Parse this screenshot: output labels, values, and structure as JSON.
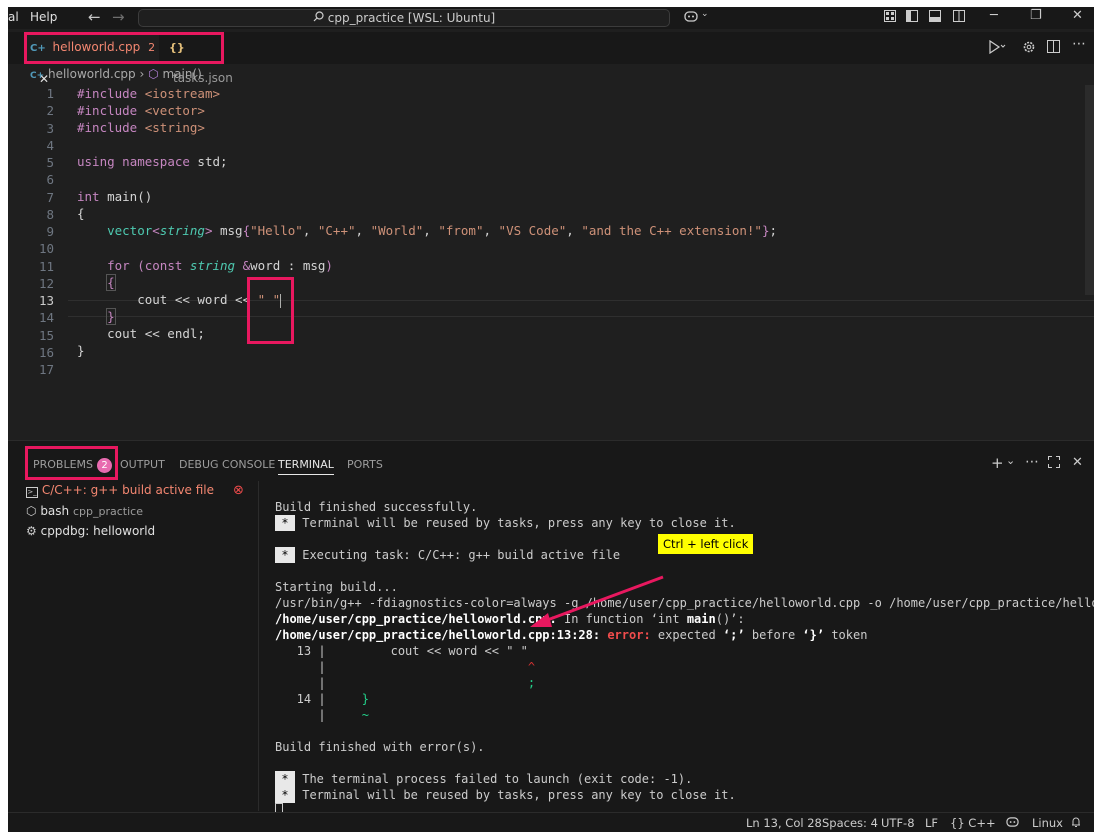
{
  "titlebar": {
    "menu_partial": "al",
    "menu_help": "Help",
    "back_glyph": "←",
    "forward_glyph": "→",
    "search_text": "cpp_practice [WSL: Ubuntu]",
    "minimize": "─",
    "maximize": "❐",
    "close": "✕"
  },
  "tabs": [
    {
      "icon": "C+",
      "label": "helloworld.cpp",
      "badge": "2",
      "close": "✕",
      "color": "#f48771"
    },
    {
      "icon": "{}",
      "label": "tasks.json",
      "color": "#999999"
    }
  ],
  "breadcrumb": {
    "file": "helloworld.cpp",
    "sep": "›",
    "symbol": "main()"
  },
  "editor": {
    "line_numbers": [
      "1",
      "2",
      "3",
      "4",
      "5",
      "6",
      "7",
      "8",
      "9",
      "10",
      "11",
      "12",
      "13",
      "14",
      "15",
      "16",
      "17"
    ],
    "current_line": "13",
    "code": [
      "#include <iostream>",
      "#include <vector>",
      "#include <string>",
      "",
      "using namespace std;",
      "",
      "int main()",
      "{",
      "    vector<string> msg{\"Hello\", \"C++\", \"World\", \"from\", \"VS Code\", \"and the C++ extension!\"};",
      "",
      "    for (const string &word : msg)",
      "    {",
      "        cout << word << \" \"",
      "    }",
      "    cout << endl;",
      "}",
      ""
    ]
  },
  "panel": {
    "tabs": [
      "PROBLEMS",
      "OUTPUT",
      "DEBUG CONSOLE",
      "TERMINAL",
      "PORTS"
    ],
    "problems_badge": "2",
    "active_tab": "TERMINAL",
    "terminals": [
      {
        "label": "C/C++: g++ build active file",
        "status": "error"
      },
      {
        "label": "bash",
        "sub": "cpp_practice"
      },
      {
        "label": "cppdbg: helloworld"
      }
    ],
    "terminal_lines": {
      "l1": "Build finished successfully.",
      "l2": " Terminal will be reused by tasks, press any key to close it.",
      "l3": " Executing task: C/C++: g++ build active file",
      "l4": "Starting build...",
      "l5": "/usr/bin/g++ -fdiagnostics-color=always -g /home/user/cpp_practice/helloworld.cpp -o /home/user/cpp_practice/helloworld",
      "l6a": "/home/user/cpp_practice/helloworld.cpp:",
      "l6b": " In function ",
      "l6c": "‘int ",
      "l6d": "main",
      "l6e": "()’",
      "l6f": ":",
      "l7a": "/home/user/cpp_practice/helloworld.cpp:13:28:",
      "l7b": " error:",
      "l7c": " expected ",
      "l7d": "‘;’",
      "l7e": " before ",
      "l7f": "‘}’",
      "l7g": " token",
      "l8a": "   13 |         cout << word << \" \"",
      "l9a": "      |                            ",
      "l9b": "^",
      "l10a": "      |                            ",
      "l10b": ";",
      "l11a": "   14 |     ",
      "l11b": "}",
      "l12a": "      |     ",
      "l12b": "~",
      "l13": "Build finished with error(s).",
      "l14": " The terminal process failed to launch (exit code: -1).",
      "l15": " Terminal will be reused by tasks, press any key to close it.",
      "star": "*"
    }
  },
  "annotation": {
    "callout": "Ctrl + left click",
    "highlight_color": "#e8185f"
  },
  "statusbar": {
    "position": "Ln 13, Col 28",
    "spaces": "Spaces: 4",
    "encoding": "UTF-8",
    "eol": "LF",
    "language_braces": "{}",
    "language": "C++",
    "os": "Linux"
  }
}
